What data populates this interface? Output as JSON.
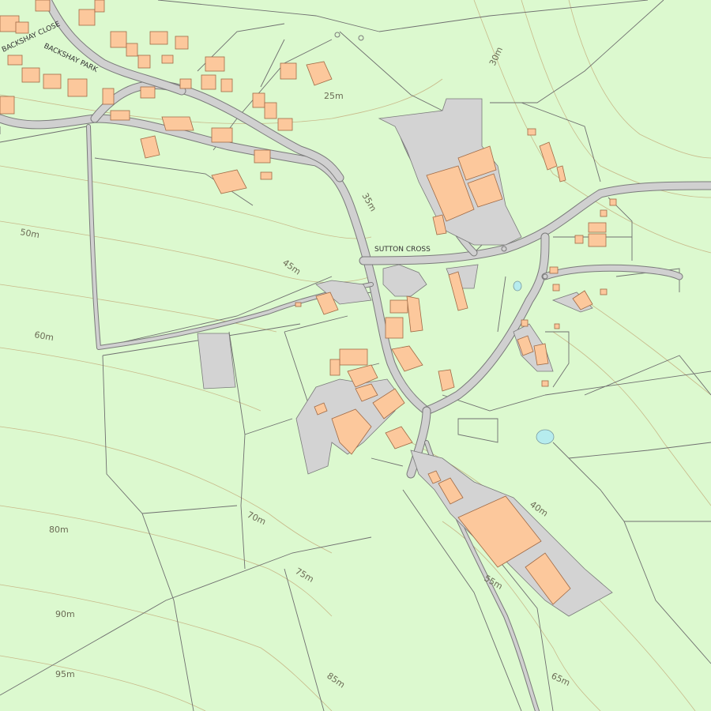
{
  "map": {
    "colors": {
      "land": "#dcf9cf",
      "building": "#fcc89c",
      "road": "#d0d0d0",
      "water": "#b6ecee",
      "contour": "#c8b98a"
    },
    "place_labels": {
      "sutton_cross": "SUTTON CROSS",
      "backshay_close": "BACKSHAY CLOSE",
      "backshay_park": "BACKSHAY PARK"
    },
    "contour_labels": {
      "c25": "25m",
      "c30": "30m",
      "c35": "35m",
      "c40": "40m",
      "c45": "45m",
      "c50": "50m",
      "c55": "55m",
      "c60": "60m",
      "c65": "65m",
      "c70": "70m",
      "c75": "75m",
      "c80": "80m",
      "c85": "85m",
      "c90": "90m",
      "c95": "95m"
    }
  }
}
